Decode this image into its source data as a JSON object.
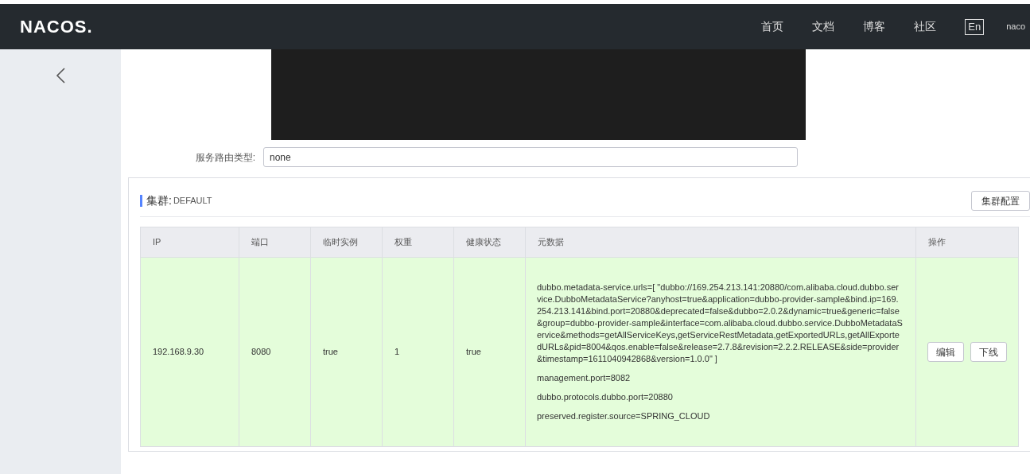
{
  "header": {
    "logo": "NACOS.",
    "nav": [
      "首页",
      "文档",
      "博客",
      "社区"
    ],
    "lang_button": "En",
    "user": "naco"
  },
  "form": {
    "label": "服务路由类型:",
    "value": "none"
  },
  "cluster": {
    "title": "集群:",
    "name": "DEFAULT",
    "config_button": "集群配置",
    "columns": [
      "IP",
      "端口",
      "临时实例",
      "权重",
      "健康状态",
      "元数据",
      "操作"
    ],
    "rows": [
      {
        "healthy": true,
        "ip": "192.168.9.30",
        "port": "8080",
        "ephemeral": "true",
        "weight": "1",
        "health": "true",
        "metadata": [
          "dubbo.metadata-service.urls=[ \"dubbo://169.254.213.141:20880/com.alibaba.cloud.dubbo.service.DubboMetadataService?anyhost=true&application=dubbo-provider-sample&bind.ip=169.254.213.141&bind.port=20880&deprecated=false&dubbo=2.0.2&dynamic=true&generic=false&group=dubbo-provider-sample&interface=com.alibaba.cloud.dubbo.service.DubboMetadataService&methods=getAllServiceKeys,getServiceRestMetadata,getExportedURLs,getAllExportedURLs&pid=8004&qos.enable=false&release=2.7.8&revision=2.2.2.RELEASE&side=provider&timestamp=1611040942868&version=1.0.0\" ]",
          "management.port=8082",
          "dubbo.protocols.dubbo.port=20880",
          "preserved.register.source=SPRING_CLOUD"
        ],
        "actions": [
          "编辑",
          "下线"
        ]
      }
    ]
  }
}
